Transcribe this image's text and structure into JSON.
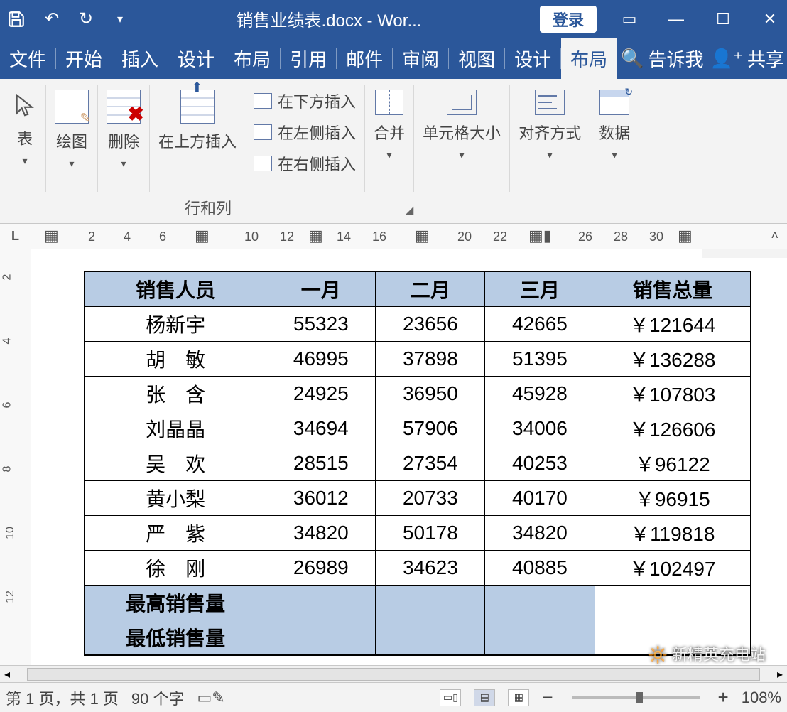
{
  "titlebar": {
    "doc_title": "销售业绩表.docx - Wor...",
    "login": "登录"
  },
  "menus": {
    "file": "文件",
    "home": "开始",
    "insert": "插入",
    "design": "设计",
    "layout": "布局",
    "refs": "引用",
    "mail": "邮件",
    "review": "审阅",
    "view": "视图",
    "table_design": "设计",
    "table_layout": "布局",
    "tell": "告诉我",
    "share": "共享"
  },
  "ribbon": {
    "table": "表",
    "draw": "绘图",
    "delete": "删除",
    "insert_above": "在上方插入",
    "insert_below": "在下方插入",
    "insert_left": "在左侧插入",
    "insert_right": "在右侧插入",
    "merge": "合并",
    "cell_size": "单元格大小",
    "align": "对齐方式",
    "data": "数据",
    "group_rows_cols": "行和列"
  },
  "ruler_h": {
    "nums": [
      "2",
      "4",
      "6",
      "10",
      "12",
      "14",
      "16",
      "20",
      "22",
      "26",
      "28",
      "30"
    ]
  },
  "ruler_v": {
    "nums": [
      "2",
      "4",
      "6",
      "8",
      "10",
      "12"
    ]
  },
  "table": {
    "headers": [
      "销售人员",
      "一月",
      "二月",
      "三月",
      "销售总量"
    ],
    "rows": [
      {
        "name": "杨新宇",
        "m1": "55323",
        "m2": "23656",
        "m3": "42665",
        "total": "￥121644"
      },
      {
        "name": "胡　敏",
        "m1": "46995",
        "m2": "37898",
        "m3": "51395",
        "total": "￥136288"
      },
      {
        "name": "张　含",
        "m1": "24925",
        "m2": "36950",
        "m3": "45928",
        "total": "￥107803"
      },
      {
        "name": "刘晶晶",
        "m1": "34694",
        "m2": "57906",
        "m3": "34006",
        "total": "￥126606"
      },
      {
        "name": "吴　欢",
        "m1": "28515",
        "m2": "27354",
        "m3": "40253",
        "total": "￥96122"
      },
      {
        "name": "黄小梨",
        "m1": "36012",
        "m2": "20733",
        "m3": "40170",
        "total": "￥96915"
      },
      {
        "name": "严　紫",
        "m1": "34820",
        "m2": "50178",
        "m3": "34820",
        "total": "￥119818"
      },
      {
        "name": "徐　刚",
        "m1": "26989",
        "m2": "34623",
        "m3": "40885",
        "total": "￥102497"
      }
    ],
    "max_label": "最高销售量",
    "min_label": "最低销售量"
  },
  "status": {
    "page": "第 1 页，共 1 页",
    "words": "90 个字",
    "zoom": "108%"
  },
  "watermark": "新精英充电站"
}
